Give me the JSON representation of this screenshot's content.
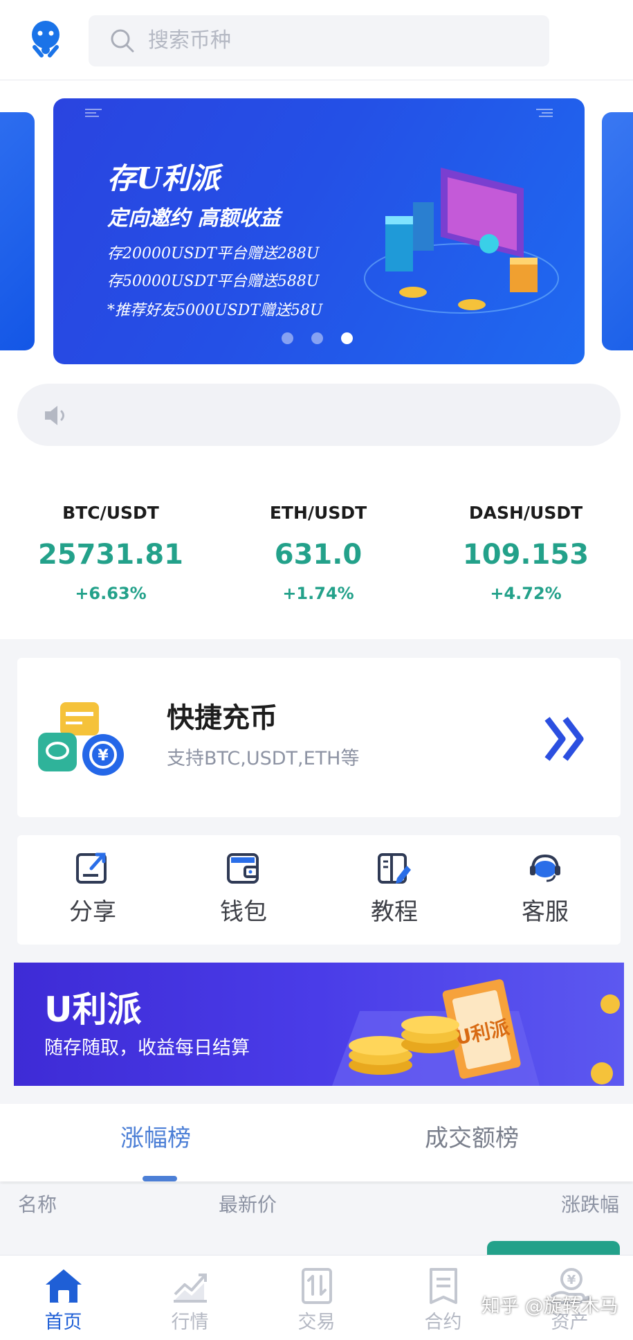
{
  "header": {
    "search_placeholder": "搜索币种"
  },
  "carousel": {
    "lines": [
      "存U利派",
      "定向邀约 高额收益",
      "存20000USDT平台赠送288U",
      "存50000USDT平台赠送588U",
      "*推荐好友5000USDT赠送58U"
    ],
    "dots": 3,
    "active_dot": 3
  },
  "tickers": [
    {
      "pair": "BTC/USDT",
      "price": "25731.81",
      "change": "+6.63%"
    },
    {
      "pair": "ETH/USDT",
      "price": "631.0",
      "change": "+1.74%"
    },
    {
      "pair": "DASH/USDT",
      "price": "109.153",
      "change": "+4.72%"
    }
  ],
  "quick_deposit": {
    "title": "快捷充币",
    "subtitle": "支持BTC,USDT,ETH等"
  },
  "shortcuts": [
    {
      "label": "分享",
      "icon": "share-icon"
    },
    {
      "label": "钱包",
      "icon": "wallet-icon"
    },
    {
      "label": "教程",
      "icon": "tutorial-icon"
    },
    {
      "label": "客服",
      "icon": "headset-icon"
    }
  ],
  "promo": {
    "title": "U利派",
    "subtitle": "随存随取，收益每日结算",
    "ticket_text": "U利派"
  },
  "rank_tabs": {
    "tabs": [
      "涨幅榜",
      "成交额榜"
    ],
    "active": 0
  },
  "columns": [
    "名称",
    "最新价",
    "涨跌幅"
  ],
  "bottom_nav": [
    {
      "label": "首页",
      "icon": "home-icon",
      "active": true
    },
    {
      "label": "行情",
      "icon": "market-chart-icon",
      "active": false
    },
    {
      "label": "交易",
      "icon": "trade-icon",
      "active": false
    },
    {
      "label": "合约",
      "icon": "contract-icon",
      "active": false
    },
    {
      "label": "资产",
      "icon": "assets-icon",
      "active": false
    }
  ],
  "watermark": "知乎 @旋转木马",
  "colors": {
    "accent_blue": "#1f5fd6",
    "up_green": "#23a18a",
    "tab_blue": "#4c7fd6",
    "promo_purple": "#4a3ce8"
  }
}
